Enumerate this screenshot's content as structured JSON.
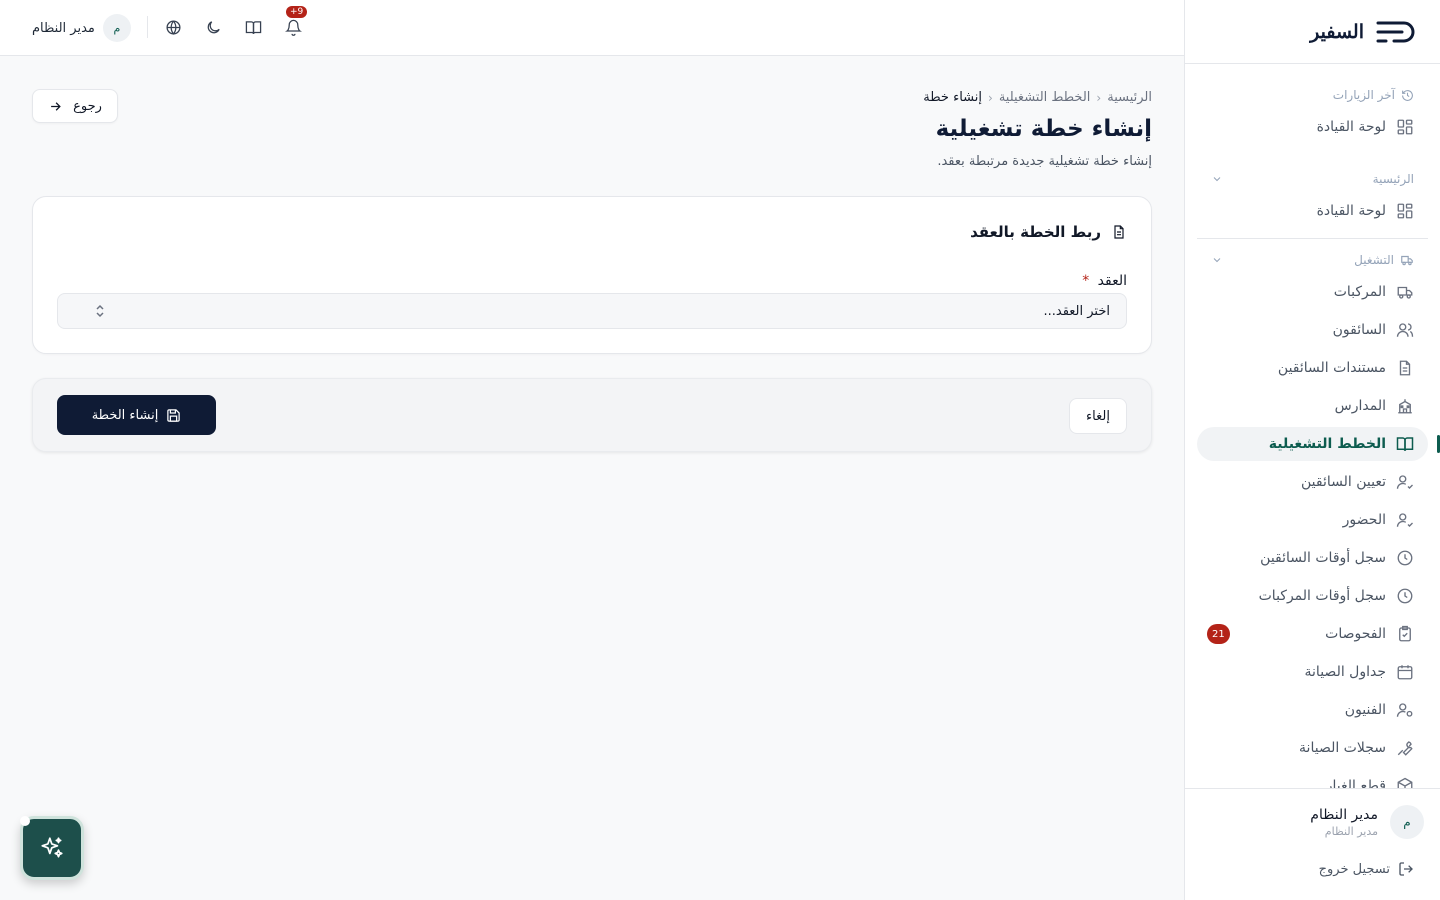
{
  "brand": {
    "name": "السفير"
  },
  "topbar": {
    "notification_count": "+9",
    "user_name": "مدير النظام",
    "user_initial": "م"
  },
  "sidebar": {
    "recent_label": "آخر الزيارات",
    "recent_items": [
      {
        "label": "لوحة القيادة",
        "icon": "dashboard-icon"
      }
    ],
    "main_label": "الرئيسية",
    "main_items": [
      {
        "label": "لوحة القيادة",
        "icon": "dashboard-icon"
      }
    ],
    "ops_label": "التشغيل",
    "ops_items": [
      {
        "label": "المركبات",
        "icon": "truck-icon"
      },
      {
        "label": "السائقون",
        "icon": "users-icon"
      },
      {
        "label": "مستندات السائقين",
        "icon": "document-icon"
      },
      {
        "label": "المدارس",
        "icon": "school-icon"
      },
      {
        "label": "الخطط التشغيلية",
        "icon": "book-open-icon",
        "active": true
      },
      {
        "label": "تعيين السائقين",
        "icon": "user-check-icon"
      },
      {
        "label": "الحضور",
        "icon": "user-check-icon"
      },
      {
        "label": "سجل أوقات السائقين",
        "icon": "clock-icon"
      },
      {
        "label": "سجل أوقات المركبات",
        "icon": "clock-icon"
      },
      {
        "label": "الفحوصات",
        "icon": "clipboard-check-icon",
        "badge": "21"
      },
      {
        "label": "جداول الصيانة",
        "icon": "calendar-icon"
      },
      {
        "label": "الفنيون",
        "icon": "user-cog-icon"
      },
      {
        "label": "سجلات الصيانة",
        "icon": "wrench-icon"
      },
      {
        "label": "قطع الغيار",
        "icon": "package-icon"
      }
    ],
    "footer": {
      "user_name": "مدير النظام",
      "user_role": "مدير النظام",
      "user_initial": "م",
      "logout_label": "تسجيل خروج"
    }
  },
  "breadcrumb": {
    "items": [
      "الرئيسية",
      "الخطط التشغيلية"
    ],
    "current": "إنشاء خطة"
  },
  "page": {
    "title": "إنشاء خطة تشغيلية",
    "subtitle": "إنشاء خطة تشغيلية جديدة مرتبطة بعقد.",
    "back_label": "رجوع"
  },
  "card": {
    "title": "ربط الخطة بالعقد",
    "field_label": "العقد",
    "required_mark": "*",
    "select_placeholder": "اختر العقد..."
  },
  "actions": {
    "create_label": "إنشاء الخطة",
    "cancel_label": "إلغاء"
  },
  "colors": {
    "primary": "#0f1b35",
    "accent": "#0d5c4f",
    "danger": "#b42318",
    "fab": "#1d4f4b"
  }
}
